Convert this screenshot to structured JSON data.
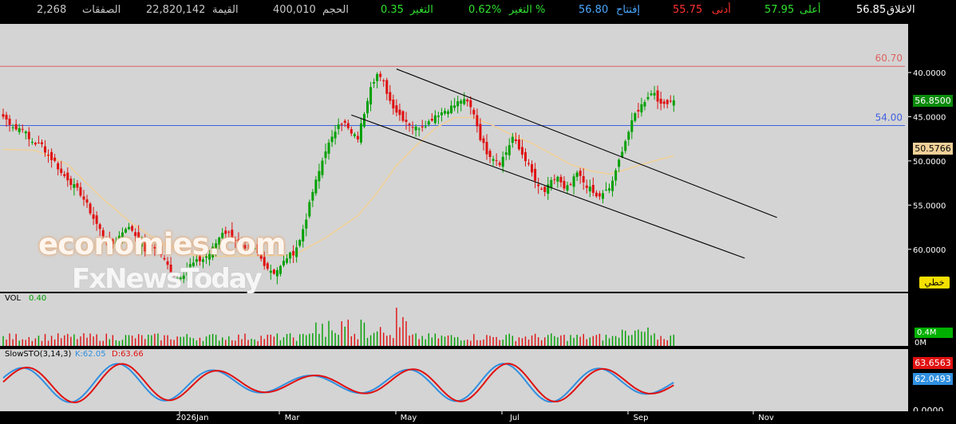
{
  "header": {
    "close_label": "الاغلاق",
    "close_value": "56.85",
    "high_label": "أعلى",
    "high_value": "57.95",
    "low_label": "أدنى",
    "low_value": "55.75",
    "open_label": "إفتتاح",
    "open_value": "56.80",
    "change_pct_label": "التغير %",
    "change_pct_value": "0.62%",
    "change_label": "التغير",
    "change_value": "0.35",
    "volume_label": "الحجم",
    "volume_value": "400,010",
    "value_label": "القيمة",
    "value_value": "22,820,142",
    "trades_label": "الصفقات",
    "trades_value": "2,268"
  },
  "colors": {
    "up": "#00a000",
    "down": "#e01010",
    "ma": "#f0d098",
    "resistance": "#e06060",
    "support": "#4060e0",
    "channel": "#000000",
    "plot_bg": "#d4d4d4",
    "k_line": "#2f8fe0",
    "d_line": "#e01010"
  },
  "main_panel": {
    "resistance_label": "60.70",
    "support_label": "54.00",
    "last_price_tag": "56.8500",
    "ma_tag": "50.5766",
    "drawing_button": "خطي",
    "y_ticks": [
      "60.0000",
      "55.0000",
      "50.0000",
      "45.0000",
      "40.0000"
    ]
  },
  "volume_panel": {
    "label": "VOL",
    "value": "0.40",
    "last_tag": "0.4M",
    "zero_tick": "0M"
  },
  "sto_panel": {
    "label": "SlowSTO(3,14,3)",
    "k_label": "K:62.05",
    "d_label": "D:63.66",
    "d_tag": "63.6563",
    "k_tag": "62.0493",
    "zero_tick": "0.0000"
  },
  "x_axis": {
    "labels": [
      "2026Jan",
      "Mar",
      "May",
      "Jul",
      "Sep",
      "Nov"
    ]
  },
  "watermark": {
    "line1": "economies.com",
    "line2": "FxNewsToday"
  },
  "chart_data": {
    "type": "candlestick",
    "x_labels": [
      "2026Jan",
      "Mar",
      "May",
      "Jul",
      "Sep",
      "Nov"
    ],
    "y_range": [
      35.2,
      65.5
    ],
    "y_ticks": [
      40,
      45,
      50,
      55,
      60
    ],
    "horizontal_levels": [
      {
        "label": "60.70",
        "value": 60.7
      },
      {
        "label": "54.00",
        "value": 54.0
      }
    ],
    "close_path": [
      [
        0,
        55.0
      ],
      [
        4,
        53.6
      ],
      [
        6,
        53.8
      ],
      [
        8,
        52.4
      ],
      [
        10,
        52.0
      ],
      [
        12,
        51.8
      ],
      [
        14,
        50.6
      ],
      [
        16,
        49.9
      ],
      [
        18,
        48.6
      ],
      [
        20,
        48.0
      ],
      [
        22,
        47.1
      ],
      [
        24,
        46.3
      ],
      [
        26,
        45.0
      ],
      [
        28,
        43.5
      ],
      [
        30,
        42.2
      ],
      [
        32,
        41.0
      ],
      [
        34,
        40.6
      ],
      [
        36,
        41.5
      ],
      [
        38,
        42.5
      ],
      [
        40,
        42.2
      ],
      [
        42,
        41.0
      ],
      [
        44,
        39.9
      ],
      [
        46,
        40.4
      ],
      [
        48,
        40.1
      ],
      [
        50,
        38.7
      ],
      [
        52,
        37.6
      ],
      [
        54,
        36.8
      ],
      [
        56,
        37.3
      ],
      [
        58,
        38.2
      ],
      [
        60,
        38.6
      ],
      [
        62,
        38.9
      ],
      [
        64,
        39.5
      ],
      [
        66,
        40.7
      ],
      [
        68,
        42.0
      ],
      [
        70,
        41.8
      ],
      [
        72,
        41.1
      ],
      [
        74,
        40.0
      ],
      [
        76,
        39.6
      ],
      [
        78,
        40.0
      ],
      [
        80,
        38.9
      ],
      [
        82,
        37.9
      ],
      [
        84,
        37.4
      ],
      [
        86,
        38.0
      ],
      [
        88,
        39.1
      ],
      [
        90,
        39.6
      ],
      [
        92,
        41.0
      ],
      [
        94,
        43.6
      ],
      [
        96,
        46.5
      ],
      [
        98,
        48.8
      ],
      [
        100,
        51.3
      ],
      [
        102,
        52.5
      ],
      [
        104,
        54.4
      ],
      [
        106,
        54.2
      ],
      [
        108,
        53.0
      ],
      [
        110,
        52.6
      ],
      [
        112,
        55.5
      ],
      [
        114,
        58.6
      ],
      [
        116,
        59.8
      ],
      [
        118,
        58.8
      ],
      [
        120,
        56.8
      ],
      [
        122,
        55.6
      ],
      [
        124,
        54.8
      ],
      [
        126,
        54.2
      ],
      [
        128,
        53.7
      ],
      [
        130,
        54.0
      ],
      [
        132,
        54.4
      ],
      [
        134,
        55.2
      ],
      [
        136,
        55.5
      ],
      [
        138,
        55.9
      ],
      [
        140,
        56.3
      ],
      [
        142,
        56.9
      ],
      [
        144,
        56.6
      ],
      [
        146,
        55.4
      ],
      [
        148,
        52.6
      ],
      [
        150,
        51.0
      ],
      [
        152,
        50.4
      ],
      [
        154,
        49.8
      ],
      [
        156,
        51.0
      ],
      [
        158,
        52.7
      ],
      [
        160,
        51.3
      ],
      [
        162,
        50.2
      ],
      [
        164,
        48.6
      ],
      [
        166,
        46.9
      ],
      [
        168,
        46.5
      ],
      [
        170,
        47.6
      ],
      [
        172,
        48.2
      ],
      [
        174,
        46.7
      ],
      [
        176,
        47.3
      ],
      [
        178,
        48.6
      ],
      [
        180,
        47.6
      ],
      [
        182,
        46.8
      ],
      [
        184,
        45.9
      ],
      [
        186,
        46.2
      ],
      [
        188,
        46.9
      ],
      [
        190,
        48.7
      ],
      [
        192,
        51.3
      ],
      [
        194,
        53.3
      ],
      [
        196,
        55.3
      ],
      [
        198,
        56.3
      ],
      [
        200,
        57.4
      ],
      [
        202,
        57.8
      ],
      [
        204,
        56.2
      ],
      [
        206,
        56.7
      ],
      [
        208,
        56.85
      ]
    ],
    "ma_path": [
      [
        0,
        51.3
      ],
      [
        10,
        51.2
      ],
      [
        20,
        49.6
      ],
      [
        30,
        46.0
      ],
      [
        40,
        42.9
      ],
      [
        50,
        40.5
      ],
      [
        60,
        39.2
      ],
      [
        70,
        39.2
      ],
      [
        80,
        39.3
      ],
      [
        90,
        39.3
      ],
      [
        100,
        41.3
      ],
      [
        110,
        43.8
      ],
      [
        116,
        46.4
      ],
      [
        122,
        49.5
      ],
      [
        128,
        51.7
      ],
      [
        134,
        53.7
      ],
      [
        140,
        54.9
      ],
      [
        146,
        54.9
      ],
      [
        152,
        54.0
      ],
      [
        158,
        52.9
      ],
      [
        164,
        52.0
      ],
      [
        170,
        50.8
      ],
      [
        176,
        49.6
      ],
      [
        182,
        48.9
      ],
      [
        188,
        48.5
      ],
      [
        192,
        48.9
      ],
      [
        198,
        49.6
      ],
      [
        204,
        50.2
      ],
      [
        208,
        50.58
      ]
    ],
    "channel_lines": [
      {
        "from": [
          108,
          55.2
        ],
        "to": [
          230,
          39.0
        ]
      },
      {
        "from": [
          122,
          60.4
        ],
        "to": [
          240,
          43.6
        ]
      }
    ],
    "last_close": 56.85,
    "ma_last": 50.5766,
    "volume_series": {
      "name": "VOL",
      "last": 0.4,
      "unit": "M"
    },
    "slow_sto": {
      "params": "3,14,3",
      "k_last": 62.0493,
      "d_last": 63.6563
    }
  }
}
